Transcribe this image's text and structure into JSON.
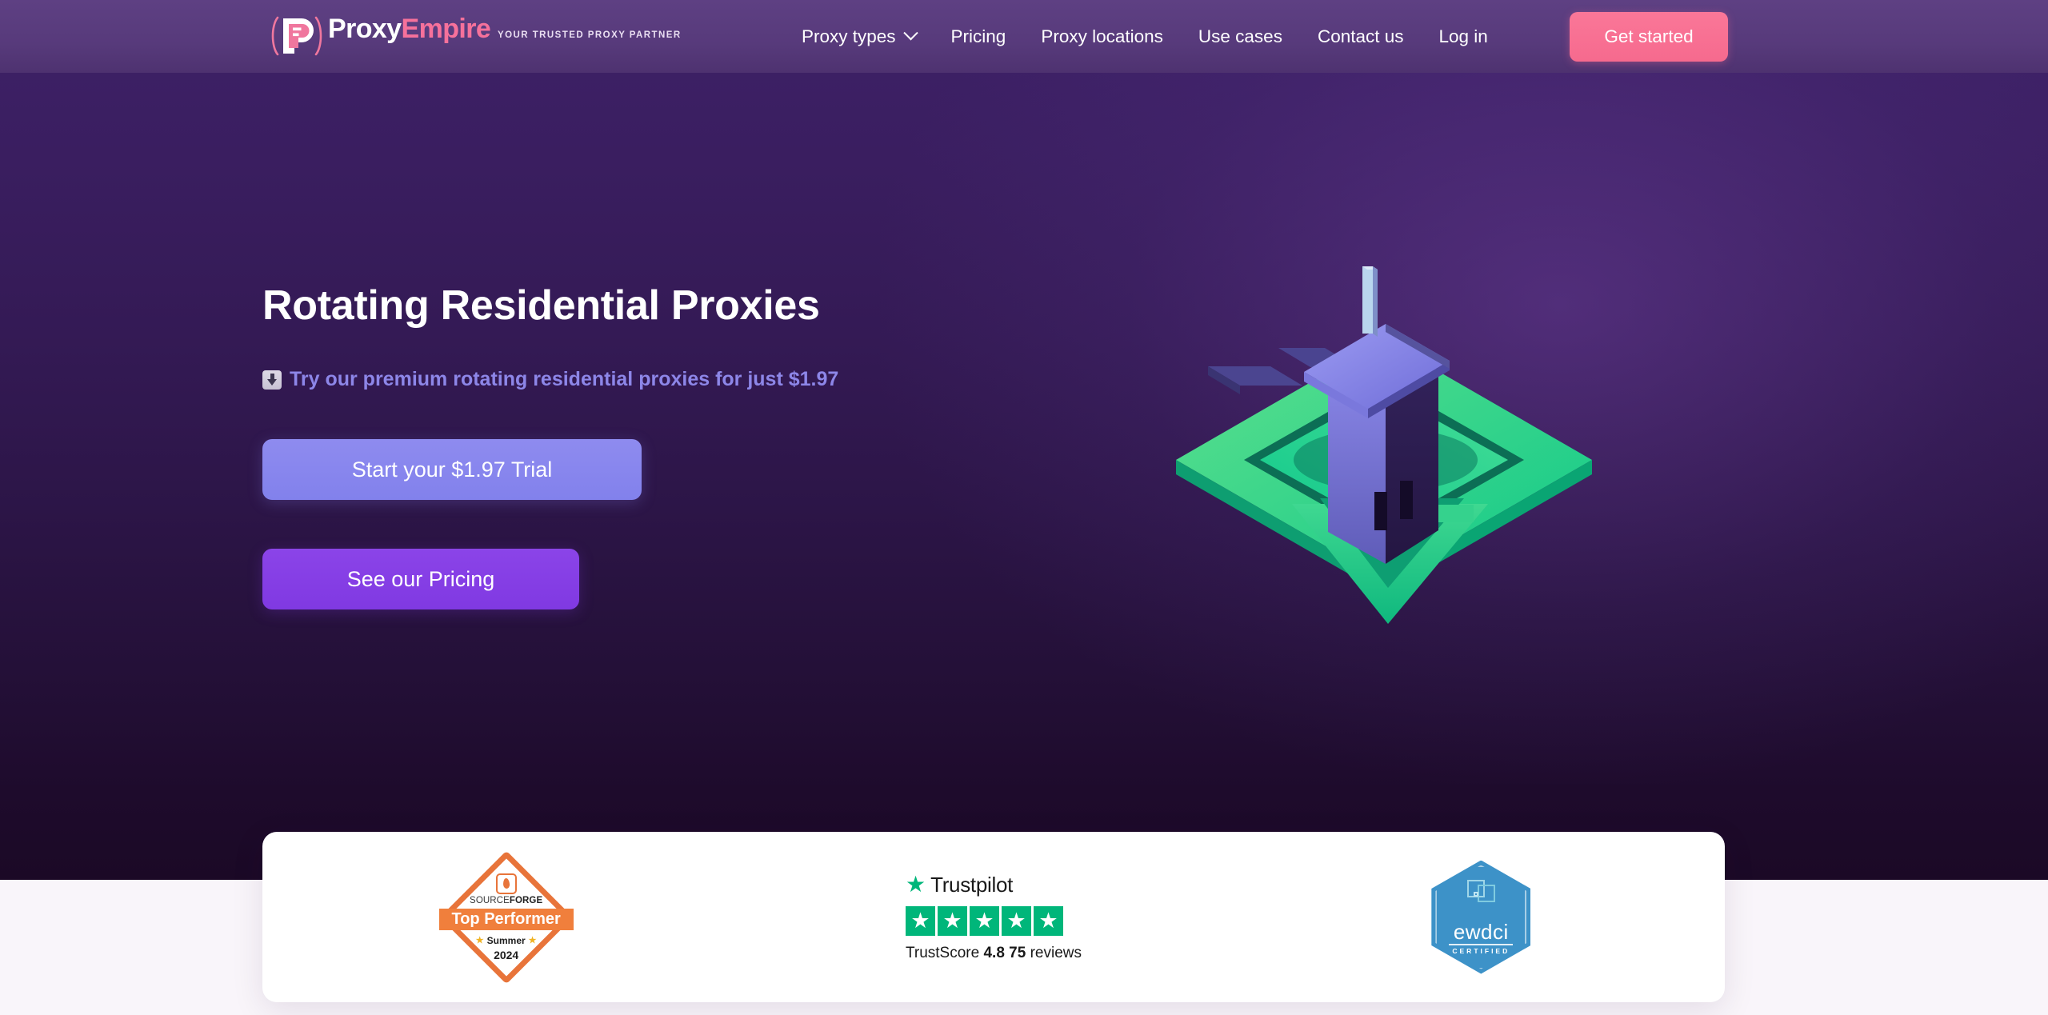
{
  "theme": {
    "header_bg": "#573A7B",
    "hero_gradient_top": "#3E2168",
    "hero_gradient_bottom": "#1B0926",
    "page_bg": "#F9F5FA",
    "accent_pink": "#F66A8E",
    "accent_periwinkle": "#8281EC",
    "accent_purple": "#8039E2",
    "subtitle_color": "#8D86E8",
    "trustpilot_green": "#00B67A",
    "sourceforge_orange": "#E8743A",
    "ewdci_blue": "#3D92C8"
  },
  "header": {
    "logo": {
      "name_part1": "Proxy",
      "name_part2": "Empire",
      "tagline": "YOUR TRUSTED PROXY PARTNER",
      "mark_icon": "proxyempire-p-logo-icon"
    },
    "nav": [
      {
        "label": "Proxy types",
        "has_dropdown": true,
        "icon": "chevron-down-icon"
      },
      {
        "label": "Pricing",
        "has_dropdown": false
      },
      {
        "label": "Proxy locations",
        "has_dropdown": false
      },
      {
        "label": "Use cases",
        "has_dropdown": false
      },
      {
        "label": "Contact us",
        "has_dropdown": false
      },
      {
        "label": "Log in",
        "has_dropdown": false
      }
    ],
    "cta_label": "Get started"
  },
  "hero": {
    "title": "Rotating Residential Proxies",
    "subtitle_icon": "down-arrow-emoji",
    "subtitle": "Try our premium rotating residential proxies for just $1.97",
    "primary_button": "Start your $1.97 Trial",
    "secondary_button": "See our Pricing",
    "illustration": "isometric-house-on-green-diamond-illustration"
  },
  "trust": {
    "sourceforge": {
      "icon": "sourceforge-flame-icon",
      "brand_part1": "SOURCE",
      "brand_part2": "FORGE",
      "award": "Top Performer",
      "season": "Summer",
      "year": "2024",
      "star_icon": "star-icon"
    },
    "trustpilot": {
      "logo_icon": "trustpilot-star-icon",
      "name": "Trustpilot",
      "stars": 5,
      "star_glyph": "★",
      "score_label": "TrustScore",
      "score": "4.8",
      "reviews_count": "75",
      "reviews_label": "reviews"
    },
    "ewdci": {
      "name": "ewdci",
      "certified": "CERTIFIED",
      "icon": "ewdci-hexagon-badge-icon"
    }
  }
}
